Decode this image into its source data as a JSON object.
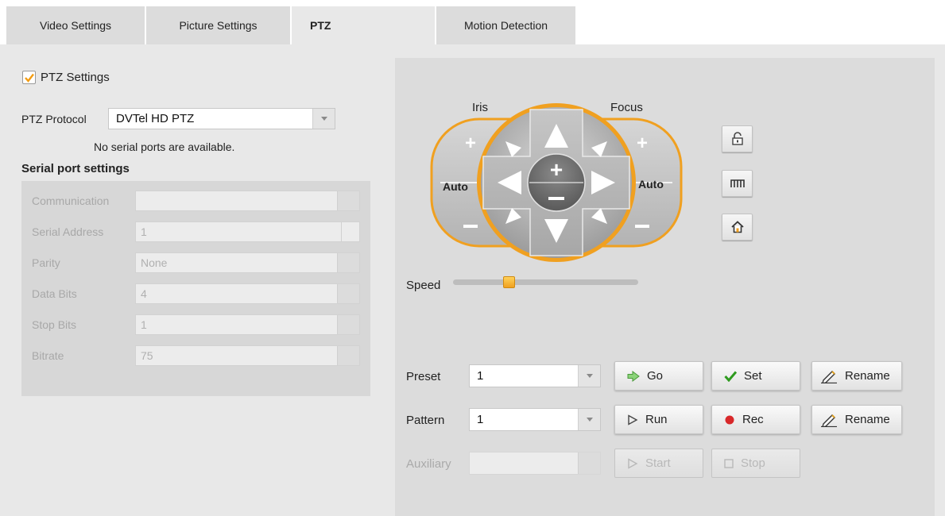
{
  "tabs": [
    {
      "label": "Video Settings"
    },
    {
      "label": "Picture Settings"
    },
    {
      "label": "PTZ"
    },
    {
      "label": "Motion Detection"
    }
  ],
  "ptz_settings": {
    "checkbox_label": "PTZ Settings",
    "checked": true,
    "protocol_label": "PTZ Protocol",
    "protocol_value": "DVTel HD PTZ",
    "serial_message": "No serial ports are available.",
    "serial_heading": "Serial port settings"
  },
  "serial_fields": [
    {
      "label": "Communication",
      "value": ""
    },
    {
      "label": "Serial Address",
      "value": "1"
    },
    {
      "label": "Parity",
      "value": "None"
    },
    {
      "label": "Data Bits",
      "value": "4"
    },
    {
      "label": "Stop Bits",
      "value": "1"
    },
    {
      "label": "Bitrate",
      "value": "75"
    }
  ],
  "controller": {
    "iris_label": "Iris",
    "focus_label": "Focus",
    "iris_auto": "Auto",
    "focus_auto": "Auto",
    "speed_label": "Speed",
    "speed_fraction": 0.3
  },
  "preset": {
    "label": "Preset",
    "value": "1",
    "go": "Go",
    "set": "Set",
    "rename": "Rename"
  },
  "pattern": {
    "label": "Pattern",
    "value": "1",
    "run": "Run",
    "rec": "Rec",
    "rename": "Rename"
  },
  "auxiliary": {
    "label": "Auxiliary",
    "value": "",
    "start": "Start",
    "stop": "Stop"
  },
  "colors": {
    "accent": "#f0a020",
    "checkbox": "#f39c12",
    "set_check": "#2e9a1e",
    "rec_dot": "#d8282a"
  }
}
